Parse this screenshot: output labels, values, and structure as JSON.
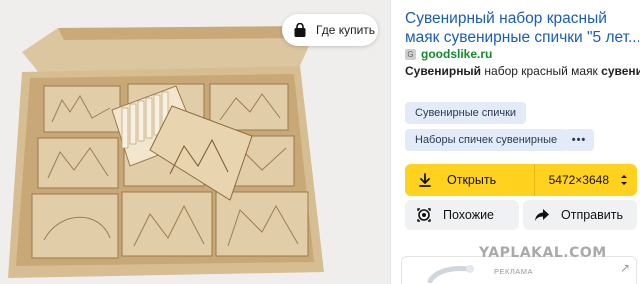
{
  "image_panel": {
    "buy_button": {
      "label": "Где купить",
      "icon": "shopping-bag-icon"
    }
  },
  "result": {
    "title_line1": "Сувенирный набор красный",
    "title_line2": "маяк сувенирные спички \"5 лет...",
    "domain": "goodslike.ru",
    "favicon_letter": "G",
    "desc_bold1": "Сувенирный",
    "desc_mid": " набор красный маяк ",
    "desc_bold2": "сувени",
    "tags": [
      "Сувенирные спички",
      "Наборы спичек сувенирные"
    ],
    "more_tags": "•••",
    "open_button": {
      "label": "Открыть",
      "size": "5472×3648",
      "icon": "download-icon"
    },
    "similar_button": {
      "label": "Похожие",
      "icon": "lens-icon"
    },
    "send_button": {
      "label": "Отправить",
      "icon": "share-arrow-icon"
    },
    "ad_label": "РЕКЛАМА"
  },
  "watermark": "YAPLAKAL.COM",
  "colors": {
    "link": "#1a5db5",
    "domain": "#138a2e",
    "accent": "#ffd21f",
    "chip_bg": "#e3ebf8",
    "button_bg": "#f0f1f3"
  }
}
